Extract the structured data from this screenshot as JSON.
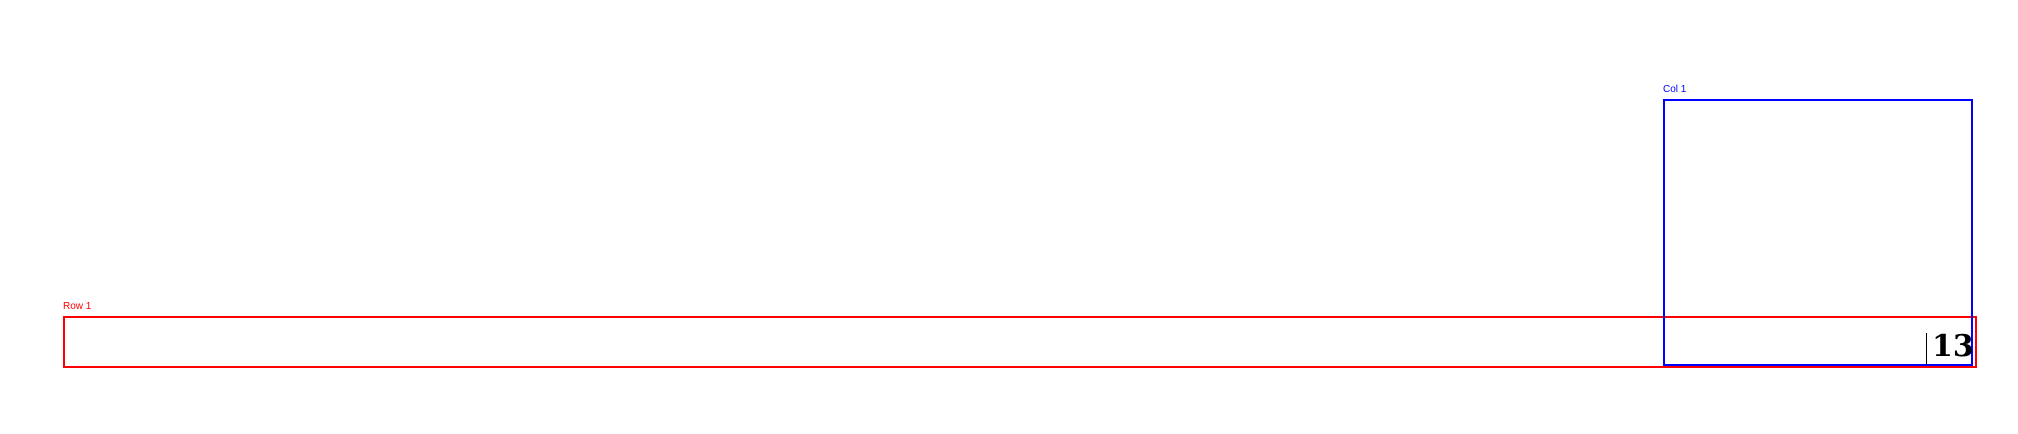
{
  "regions": {
    "row_label": "Row 1",
    "col_label": "Col 1"
  },
  "cell": {
    "value": "13"
  },
  "colors": {
    "row": "#ff0000",
    "col": "#0000ff"
  }
}
